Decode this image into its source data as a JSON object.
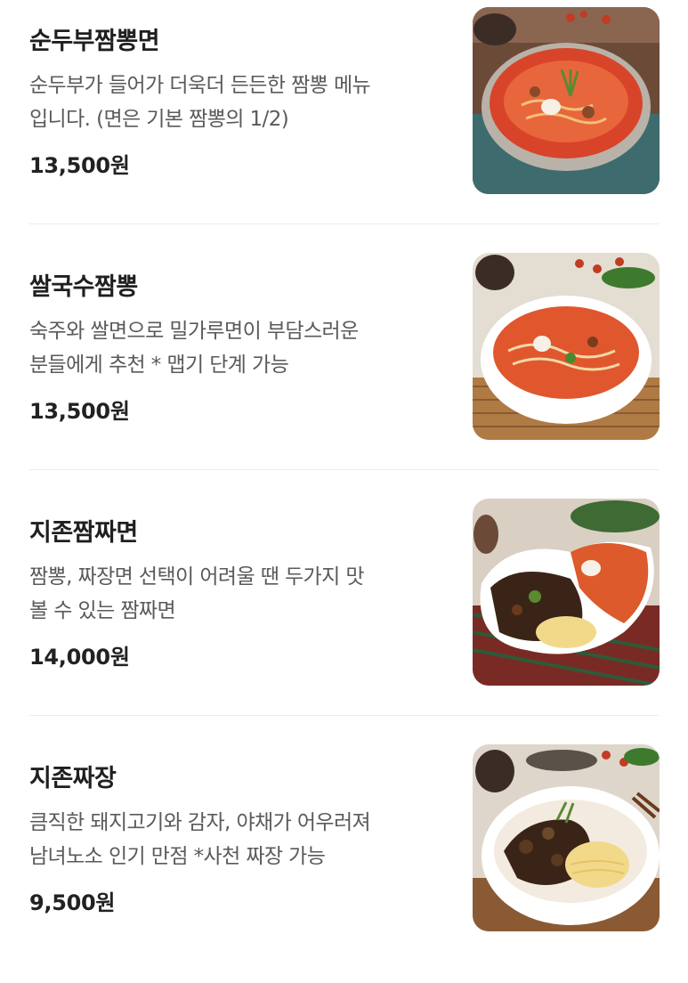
{
  "menu": {
    "items": [
      {
        "name": "순두부짬뽕면",
        "description_lines": [
          "순두부가 들어가 더욱더 든든한 짬뽕 메뉴",
          "입니다. (면은 기본 짬뽕의 1/2)"
        ],
        "price": "13,500원",
        "image": "sundubu-jjamppong-photo"
      },
      {
        "name": "쌀국수짬뽕",
        "description_lines": [
          "숙주와 쌀면으로 밀가루면이 부담스러운",
          "분들에게 추천 * 맵기 단계 가능"
        ],
        "price": "13,500원",
        "image": "rice-noodle-jjamppong-photo"
      },
      {
        "name": "지존짬짜면",
        "description_lines": [
          "짬뽕, 짜장면 선택이 어려울 땐 두가지 맛",
          "볼 수 있는 짬짜면"
        ],
        "price": "14,000원",
        "image": "jjamjjamyeon-photo"
      },
      {
        "name": "지존짜장",
        "description_lines": [
          "큼직한 돼지고기와 감자, 야채가 어우러져",
          "남녀노소 인기 만점 *사천 짜장 가능"
        ],
        "price": "9,500원",
        "image": "jjajang-photo"
      }
    ]
  },
  "colors": {
    "background": "#ffffff",
    "title_text": "#1f1f1f",
    "description_text": "#5a5a5a",
    "divider": "#ececec"
  }
}
